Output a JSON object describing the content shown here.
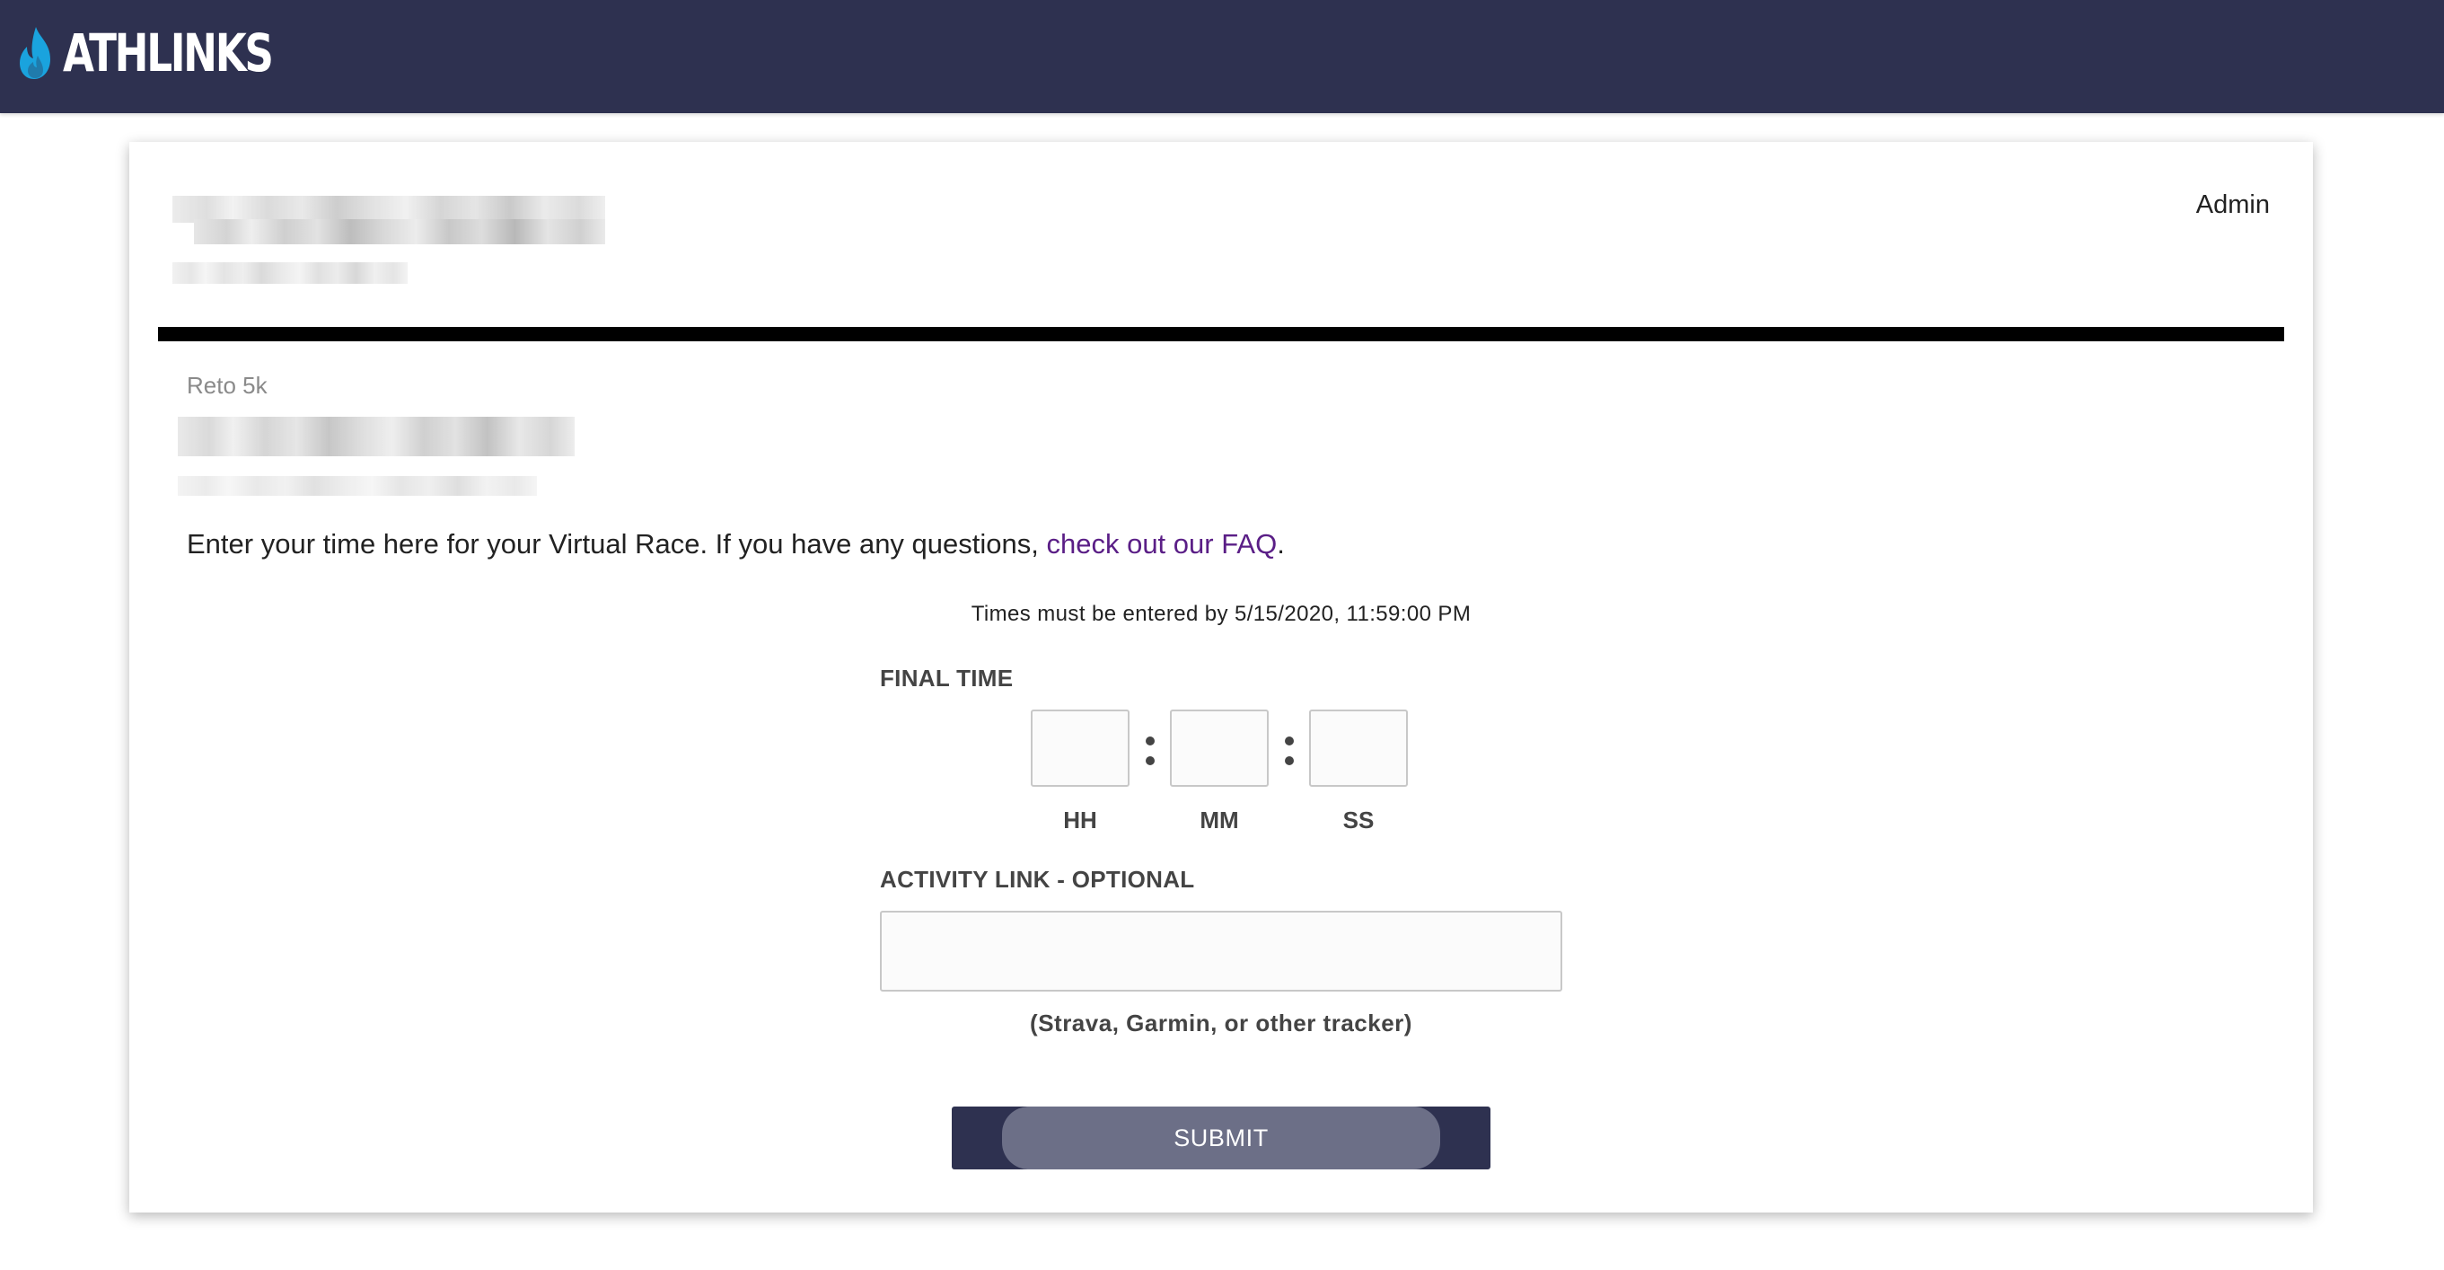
{
  "header": {
    "brand": "ATHLINKS",
    "logo_icon": "flame-icon",
    "background": "#2e3150",
    "flame_color": "#1aa3de"
  },
  "card": {
    "admin_label": "Admin",
    "event_name": "Reto 5k",
    "intro_text": "Enter your time here for your Virtual Race. If you have any questions, ",
    "faq_link": "check out our FAQ",
    "intro_end": ".",
    "deadline": "Times must be entered by 5/15/2020, 11:59:00 PM"
  },
  "form": {
    "final_time_label": "FINAL TIME",
    "hours_unit": "HH",
    "minutes_unit": "MM",
    "seconds_unit": "SS",
    "hours_value": "",
    "minutes_value": "",
    "seconds_value": "",
    "activity_link_label": "ACTIVITY LINK - OPTIONAL",
    "activity_link_value": "",
    "activity_link_hint": "(Strava, Garmin, or other tracker)",
    "submit_label": "SUBMIT"
  },
  "colors": {
    "link": "#5a1e86",
    "button": "#2e3150",
    "button_inner": "#6c6f87"
  }
}
